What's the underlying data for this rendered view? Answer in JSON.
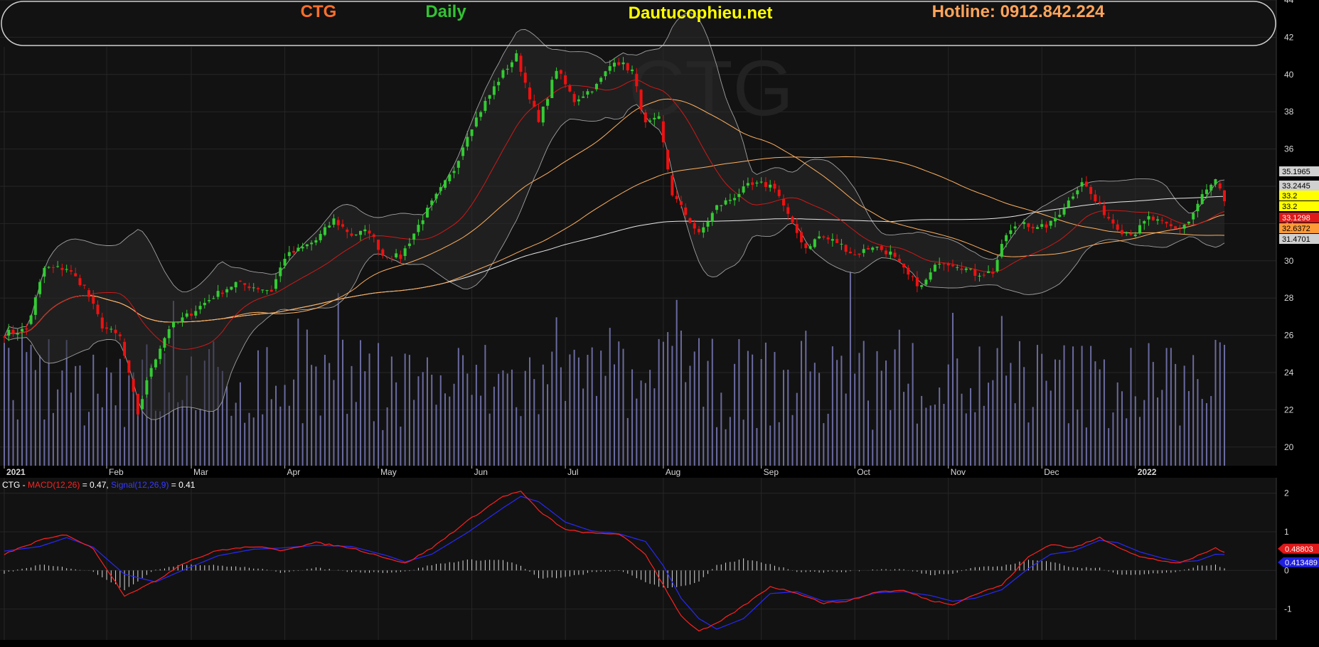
{
  "header": {
    "symbol": "CTG",
    "period": "Daily",
    "site": "Dautucophieu.net",
    "hotline": "Hotline: 0912.842.224",
    "watermark": "CTG",
    "colors": {
      "symbol": "#ff6f2a",
      "period": "#33c233",
      "site": "#ffff00",
      "hotline": "#ffa45a"
    }
  },
  "chart_data": [
    {
      "type": "candlestick",
      "symbol": "CTG",
      "ylim": [
        19,
        44
      ],
      "y_ticks": [
        20,
        22,
        24,
        26,
        28,
        30,
        32,
        34,
        36,
        38,
        40,
        42,
        44
      ],
      "x_labels": [
        "2021",
        "Feb",
        "Mar",
        "Apr",
        "May",
        "Jun",
        "Jul",
        "Aug",
        "Sep",
        "Oct",
        "Nov",
        "Dec",
        "2022"
      ],
      "grid": true,
      "waypoints_close": [
        [
          0,
          26.1
        ],
        [
          5,
          26.3
        ],
        [
          9,
          29.6
        ],
        [
          14,
          29.6
        ],
        [
          18,
          28.6
        ],
        [
          22,
          26.5
        ],
        [
          26,
          25.9
        ],
        [
          30,
          21.8
        ],
        [
          33,
          24.3
        ],
        [
          37,
          26.4
        ],
        [
          42,
          27.2
        ],
        [
          47,
          28.1
        ],
        [
          52,
          28.8
        ],
        [
          56,
          28.6
        ],
        [
          60,
          28.4
        ],
        [
          63,
          30.2
        ],
        [
          67,
          30.7
        ],
        [
          70,
          31.1
        ],
        [
          74,
          32.2
        ],
        [
          78,
          31.4
        ],
        [
          82,
          31.6
        ],
        [
          85,
          30.3
        ],
        [
          89,
          30.2
        ],
        [
          93,
          31.9
        ],
        [
          96,
          33.1
        ],
        [
          101,
          34.9
        ],
        [
          104,
          36.8
        ],
        [
          108,
          38.5
        ],
        [
          112,
          40.1
        ],
        [
          115,
          41.0
        ],
        [
          120,
          37.4
        ],
        [
          124,
          40.3
        ],
        [
          128,
          38.6
        ],
        [
          133,
          39.4
        ],
        [
          137,
          40.8
        ],
        [
          141,
          40.2
        ],
        [
          144,
          37.3
        ],
        [
          147,
          37.6
        ],
        [
          150,
          33.6
        ],
        [
          153,
          32.5
        ],
        [
          156,
          31.4
        ],
        [
          160,
          32.9
        ],
        [
          163,
          33.3
        ],
        [
          167,
          34.0
        ],
        [
          170,
          34.1
        ],
        [
          173,
          34.0
        ],
        [
          177,
          31.9
        ],
        [
          180,
          30.7
        ],
        [
          183,
          31.3
        ],
        [
          187,
          31.0
        ],
        [
          191,
          30.3
        ],
        [
          195,
          30.8
        ],
        [
          199,
          30.4
        ],
        [
          203,
          29.2
        ],
        [
          206,
          28.6
        ],
        [
          210,
          30.0
        ],
        [
          214,
          29.8
        ],
        [
          218,
          29.3
        ],
        [
          222,
          29.4
        ],
        [
          225,
          31.4
        ],
        [
          229,
          32.1
        ],
        [
          232,
          31.7
        ],
        [
          235,
          32.0
        ],
        [
          239,
          33.2
        ],
        [
          242,
          34.3
        ],
        [
          245,
          33.2
        ],
        [
          248,
          32.3
        ],
        [
          251,
          31.6
        ],
        [
          254,
          31.5
        ],
        [
          257,
          32.3
        ],
        [
          260,
          32.0
        ],
        [
          263,
          31.7
        ],
        [
          266,
          32.1
        ],
        [
          269,
          33.5
        ],
        [
          272,
          34.3
        ],
        [
          274,
          33.2
        ]
      ],
      "sessions": 275,
      "last_price": 33.2
    },
    {
      "type": "line",
      "name": "CTG - MACD(12,26) = 0.47, Signal(12,26,9) = 0.41",
      "series": [
        {
          "name": "MACD(12,26)",
          "color": "#ff2020",
          "value": 0.47
        },
        {
          "name": "Signal(12,26,9)",
          "color": "#2828ff",
          "value": 0.41
        }
      ],
      "ylim": [
        -1.8,
        2.4
      ],
      "y_ticks": [
        2,
        1,
        0,
        -1
      ],
      "waypoints_macd": [
        [
          0,
          0.42
        ],
        [
          8,
          0.78
        ],
        [
          14,
          0.93
        ],
        [
          20,
          0.56
        ],
        [
          27,
          -0.65
        ],
        [
          34,
          -0.28
        ],
        [
          40,
          0.18
        ],
        [
          48,
          0.52
        ],
        [
          56,
          0.62
        ],
        [
          62,
          0.52
        ],
        [
          70,
          0.72
        ],
        [
          78,
          0.58
        ],
        [
          86,
          0.32
        ],
        [
          90,
          0.18
        ],
        [
          96,
          0.58
        ],
        [
          104,
          1.28
        ],
        [
          112,
          1.92
        ],
        [
          116,
          2.05
        ],
        [
          120,
          1.55
        ],
        [
          126,
          1.05
        ],
        [
          132,
          0.96
        ],
        [
          138,
          0.95
        ],
        [
          144,
          0.42
        ],
        [
          148,
          -0.38
        ],
        [
          152,
          -1.18
        ],
        [
          156,
          -1.58
        ],
        [
          160,
          -1.38
        ],
        [
          166,
          -0.92
        ],
        [
          172,
          -0.42
        ],
        [
          178,
          -0.58
        ],
        [
          184,
          -0.85
        ],
        [
          190,
          -0.78
        ],
        [
          196,
          -0.55
        ],
        [
          202,
          -0.52
        ],
        [
          208,
          -0.78
        ],
        [
          213,
          -0.88
        ],
        [
          218,
          -0.62
        ],
        [
          224,
          -0.38
        ],
        [
          230,
          0.35
        ],
        [
          235,
          0.68
        ],
        [
          240,
          0.58
        ],
        [
          246,
          0.85
        ],
        [
          250,
          0.62
        ],
        [
          255,
          0.35
        ],
        [
          260,
          0.25
        ],
        [
          264,
          0.18
        ],
        [
          268,
          0.38
        ],
        [
          272,
          0.58
        ],
        [
          274,
          0.48
        ]
      ],
      "waypoints_signal": [
        [
          0,
          0.5
        ],
        [
          8,
          0.62
        ],
        [
          14,
          0.85
        ],
        [
          20,
          0.6
        ],
        [
          27,
          -0.1
        ],
        [
          34,
          -0.3
        ],
        [
          40,
          0.0
        ],
        [
          48,
          0.38
        ],
        [
          56,
          0.55
        ],
        [
          62,
          0.58
        ],
        [
          70,
          0.65
        ],
        [
          78,
          0.62
        ],
        [
          86,
          0.38
        ],
        [
          90,
          0.22
        ],
        [
          96,
          0.42
        ],
        [
          104,
          0.98
        ],
        [
          112,
          1.62
        ],
        [
          116,
          1.92
        ],
        [
          120,
          1.78
        ],
        [
          126,
          1.25
        ],
        [
          132,
          1.02
        ],
        [
          138,
          0.95
        ],
        [
          144,
          0.75
        ],
        [
          148,
          0.12
        ],
        [
          152,
          -0.72
        ],
        [
          156,
          -1.25
        ],
        [
          160,
          -1.52
        ],
        [
          166,
          -1.25
        ],
        [
          172,
          -0.6
        ],
        [
          178,
          -0.55
        ],
        [
          184,
          -0.8
        ],
        [
          190,
          -0.75
        ],
        [
          196,
          -0.58
        ],
        [
          202,
          -0.55
        ],
        [
          208,
          -0.65
        ],
        [
          213,
          -0.8
        ],
        [
          218,
          -0.72
        ],
        [
          224,
          -0.5
        ],
        [
          230,
          0.05
        ],
        [
          235,
          0.42
        ],
        [
          240,
          0.5
        ],
        [
          246,
          0.78
        ],
        [
          250,
          0.72
        ],
        [
          255,
          0.48
        ],
        [
          260,
          0.32
        ],
        [
          264,
          0.22
        ],
        [
          268,
          0.25
        ],
        [
          272,
          0.42
        ],
        [
          274,
          0.41
        ]
      ]
    }
  ],
  "price_tags": [
    {
      "value": 35.1965,
      "label": "35.1965",
      "bg": "#d0d0d0",
      "fg": "#000000"
    },
    {
      "value": 33.2445,
      "label": "33.2445",
      "bg": "#d0d0d0",
      "fg": "#000000"
    },
    {
      "value": 33.2,
      "label": "33.2",
      "bg": "#ffff00",
      "fg": "#000000"
    },
    {
      "value": 33.2,
      "label": "33.2",
      "bg": "#ffff00",
      "fg": "#000000"
    },
    {
      "value": 33.1298,
      "label": "33.1298",
      "bg": "#e01818",
      "fg": "#ffffff"
    },
    {
      "value": 32.6372,
      "label": "32.6372",
      "bg": "#ff9a38",
      "fg": "#000000"
    },
    {
      "value": 31.4701,
      "label": "31.4701",
      "bg": "#d0d0d0",
      "fg": "#000000"
    }
  ],
  "macd_tags": [
    {
      "value": 0.48803,
      "label": "0.48803",
      "bg": "#e01818",
      "fg": "#ffffff"
    },
    {
      "value": 0.413489,
      "label": "0.413489",
      "bg": "#2020e0",
      "fg": "#ffffff"
    }
  ],
  "macd_legend": {
    "prefix": "CTG - ",
    "macd_label": "MACD(12,26)",
    "macd_value": " = 0.47, ",
    "signal_label": "Signal(12,26,9)",
    "signal_value": " = 0.41"
  },
  "colors": {
    "background": "#000000",
    "up": "#33cc33",
    "down": "#ee1111",
    "volume": "#6a6aa0",
    "ma_fast": "#d01818",
    "ma_mid": "#ffb060",
    "ma_slow": "#e8e8e8",
    "bollinger": "#a0a0a0"
  }
}
